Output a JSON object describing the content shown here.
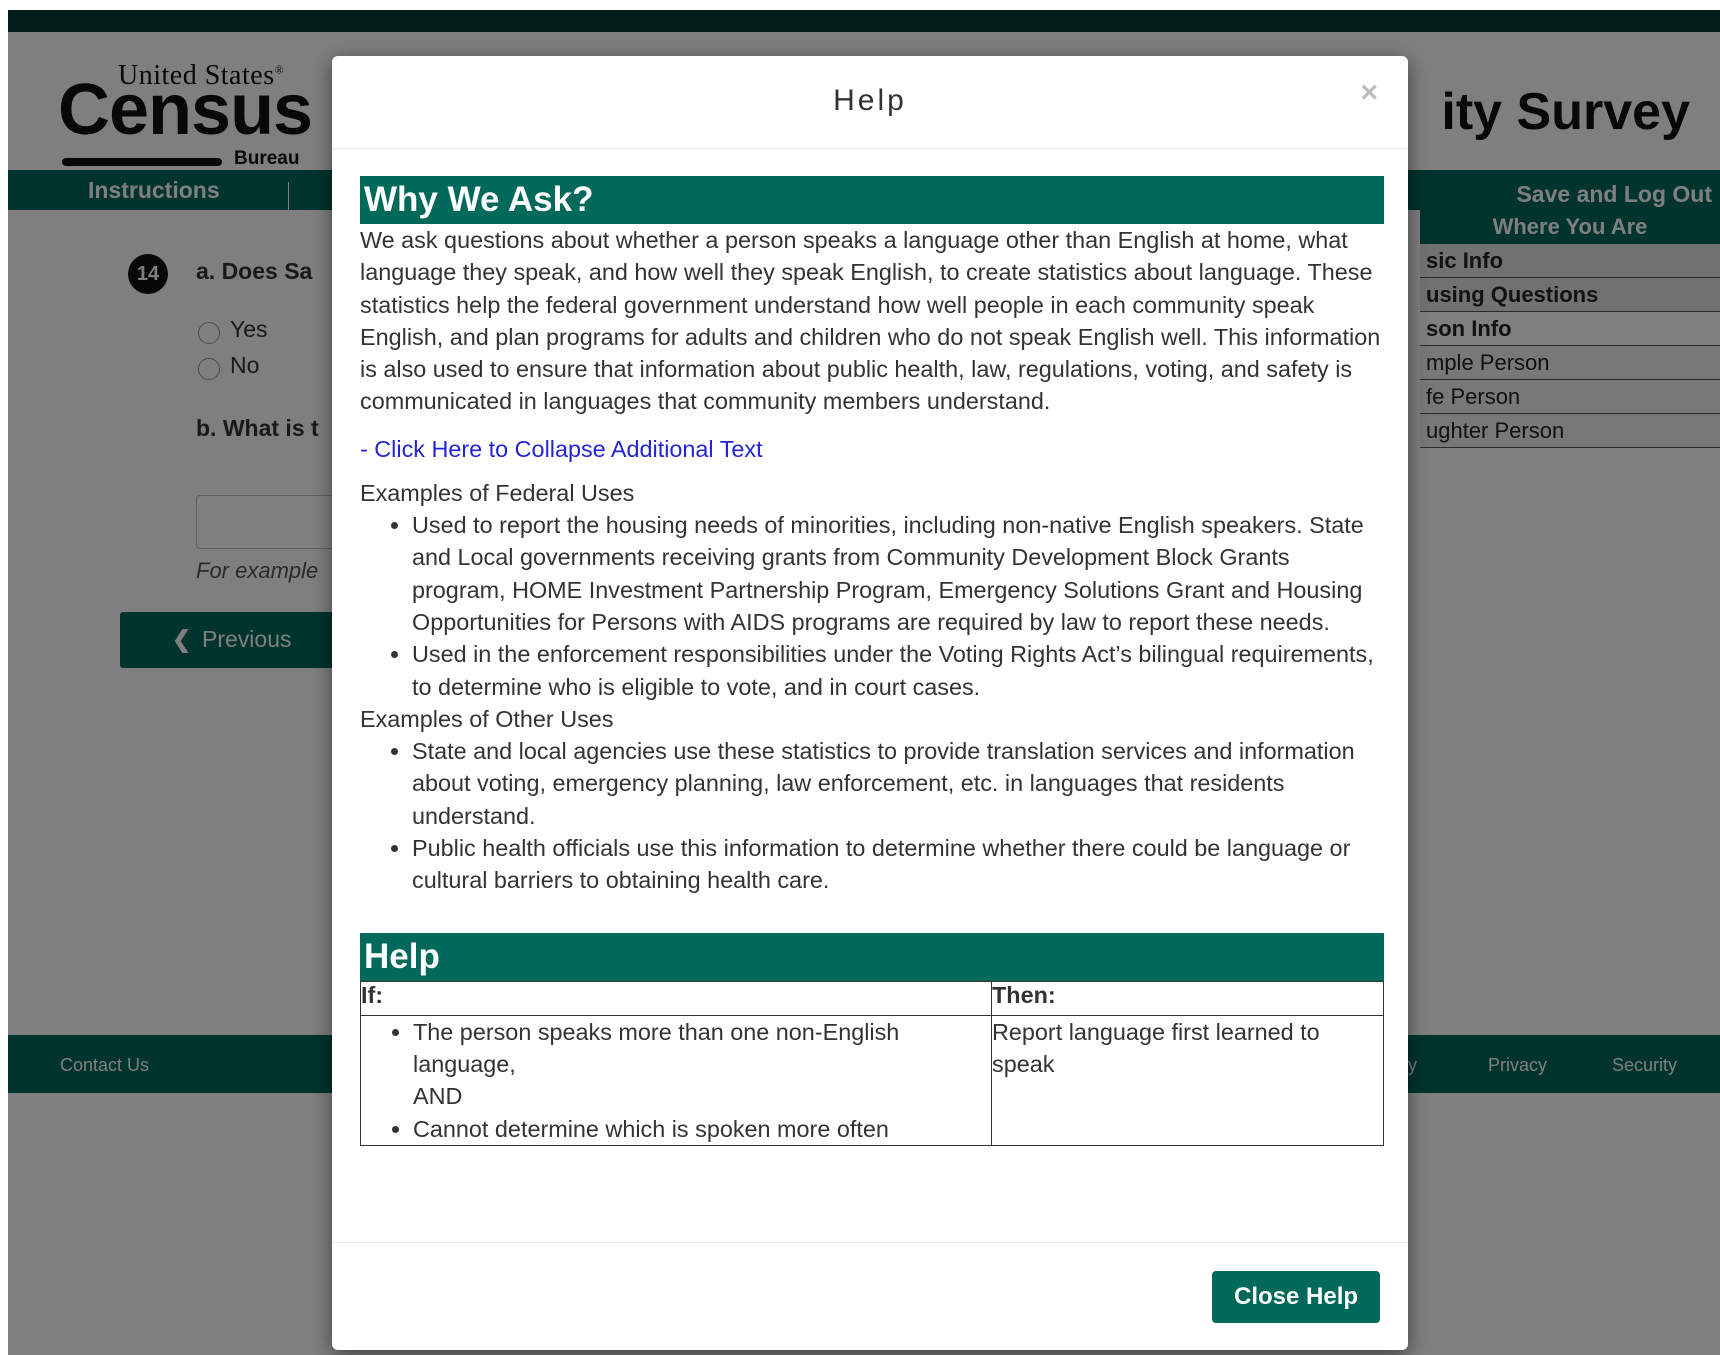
{
  "page": {
    "title_partial": "ity Survey",
    "logo": {
      "top": "United States",
      "mark": "®",
      "main": "Census",
      "bottom": "Bureau"
    },
    "nav": {
      "instructions": "Instructions",
      "save": "Save and Log Out"
    }
  },
  "question": {
    "number": "14",
    "a_text": "a. Does Sa",
    "options": [
      "Yes",
      "No"
    ],
    "b_text": "b. What is t",
    "hint": "For example",
    "previous": "Previous"
  },
  "sidebar": {
    "heading": "Where You Are",
    "items": [
      {
        "label": "sic Info",
        "style": "section"
      },
      {
        "label": "using Questions",
        "style": "section"
      },
      {
        "label": "son Info",
        "style": "current"
      },
      {
        "label": "mple Person",
        "style": "item"
      },
      {
        "label": "fe Person",
        "style": "item"
      },
      {
        "label": "ughter Person",
        "style": "item"
      }
    ]
  },
  "footer": {
    "contact": "Contact Us",
    "accessibility": "y",
    "privacy": "Privacy",
    "security": "Security"
  },
  "modal": {
    "title": "Help",
    "close_icon": "×",
    "why_heading": "Why We Ask?",
    "why_text": "We ask questions about whether a person speaks a language other than English at home, what language they speak, and how well they speak English, to create statistics about language. These statistics help the federal government understand how well people in each community speak English, and plan programs for adults and children who do not speak English well. This information is also used to ensure that information about public health, law, regulations, voting, and safety is communicated in languages that community members understand.",
    "collapse_link": "- Click Here to Collapse Additional Text",
    "federal_heading": "Examples of Federal Uses",
    "federal_uses": [
      "Used to report the housing needs of minorities, including non-native English speakers. State and Local governments receiving grants from Community Development Block Grants program, HOME Investment Partnership Program, Emergency Solutions Grant and Housing Opportunities for Persons with AIDS programs are required by law to report these needs.",
      "Used in the enforcement responsibilities under the Voting Rights Act’s bilingual requirements, to determine who is eligible to vote, and in court cases."
    ],
    "other_heading": "Examples of Other Uses",
    "other_uses": [
      "State and local agencies use these statistics to provide translation services and information about voting, emergency planning, law enforcement, etc. in languages that residents understand.",
      "Public health officials use this information to determine whether there could be language or cultural barriers to obtaining health care."
    ],
    "help_heading": "Help",
    "table": {
      "col_if": "If:",
      "col_then": "Then:",
      "if_1": "The person speaks more than one non-English language,",
      "if_and": "AND",
      "if_2": "Cannot determine which is spoken more often",
      "then": "Report language first learned to speak"
    },
    "close_button": "Close Help"
  },
  "colors": {
    "brand_green": "#00695a",
    "dark_green": "#003b32",
    "link_blue": "#2424d8"
  }
}
